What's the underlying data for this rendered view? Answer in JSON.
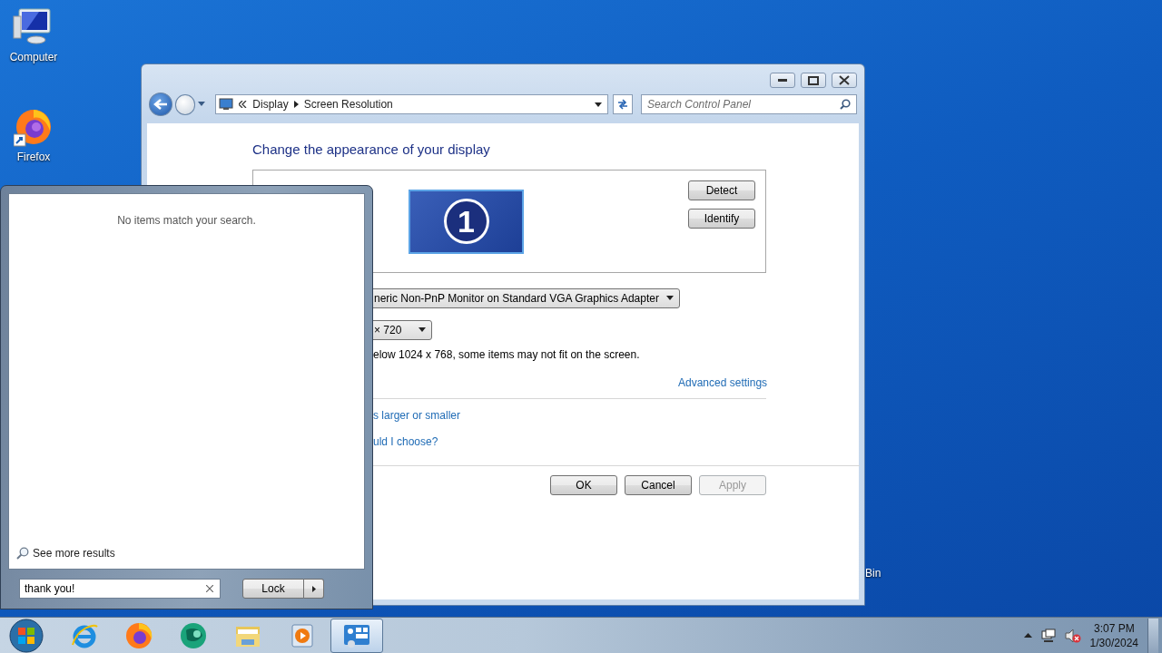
{
  "desktop_icons": [
    {
      "kind": "computer",
      "label": "Computer"
    },
    {
      "kind": "firefox",
      "label": "Firefox"
    },
    {
      "kind": "bin",
      "label": "Bin"
    }
  ],
  "window": {
    "crumbs": [
      "Display",
      "Screen Resolution"
    ],
    "search": {
      "placeholder": "Search Control Panel"
    },
    "heading": "Change the appearance of your display",
    "monitor_number": "1",
    "side_buttons": [
      "Detect",
      "Identify"
    ],
    "display_select": "neric Non-PnP Monitor on Standard VGA Graphics Adapter",
    "resolution_select": "× 720",
    "warning": "elow 1024 x 768, some items may not fit on the screen.",
    "advanced_link": "Advanced settings",
    "links": [
      "s larger or smaller",
      "uld I choose?"
    ],
    "buttons": [
      {
        "label": "OK",
        "disabled": false
      },
      {
        "label": "Cancel",
        "disabled": false
      },
      {
        "label": "Apply",
        "disabled": true
      }
    ]
  },
  "start_menu": {
    "message": "No items match your search.",
    "see_more": "See more results",
    "search": {
      "value": "thank you!"
    },
    "power_button": "Lock"
  },
  "taskbar": {
    "apps": [
      {
        "kind": "browser-e",
        "selected": false
      },
      {
        "kind": "firefox",
        "selected": false
      },
      {
        "kind": "green-app",
        "selected": false
      },
      {
        "kind": "folder",
        "selected": false
      },
      {
        "kind": "media",
        "selected": false
      },
      {
        "kind": "control-panel",
        "selected": true
      }
    ],
    "clock": {
      "time": "3:07 PM",
      "date": "1/30/2024"
    }
  }
}
